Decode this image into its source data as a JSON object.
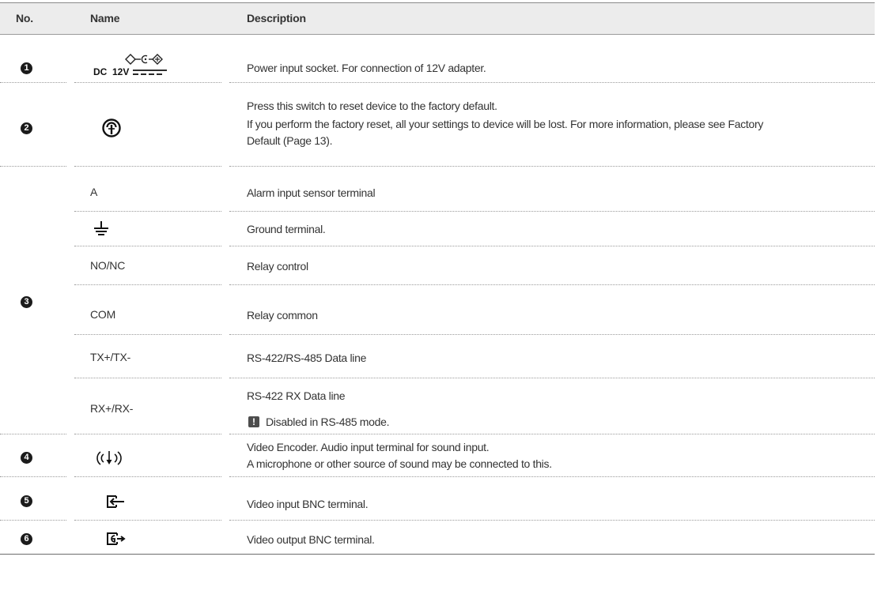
{
  "header": {
    "no": "No.",
    "name": "Name",
    "description": "Description"
  },
  "rows": [
    {
      "num": "1",
      "icon": "dc-power-icon",
      "icon_text": "DC 12V",
      "desc": [
        "Power input socket. For connection of 12V adapter."
      ]
    },
    {
      "num": "2",
      "icon": "reset-switch-icon",
      "desc": [
        "Press this switch to reset device to the factory default.",
        "If you perform the factory reset, all your settings to device will be lost. For more information, please see Factory",
        "Default (Page 13)."
      ]
    },
    {
      "num": "3",
      "sub": [
        {
          "name": "A",
          "desc": "Alarm input sensor terminal"
        },
        {
          "icon": "ground-icon",
          "desc": "Ground terminal."
        },
        {
          "name": "NO/NC",
          "desc": "Relay control"
        },
        {
          "name": "COM",
          "desc": "Relay common"
        },
        {
          "name": "TX+/TX-",
          "desc": "RS-422/RS-485 Data line"
        },
        {
          "name": "RX+/RX-",
          "desc": "RS-422 RX Data line",
          "note_icon": "!",
          "note": "Disabled in RS-485 mode."
        }
      ]
    },
    {
      "num": "4",
      "icon": "audio-input-icon",
      "desc": [
        "Video Encoder. Audio input terminal for sound input.",
        "A microphone or other source of sound may be connected to this."
      ]
    },
    {
      "num": "5",
      "icon": "video-input-icon",
      "desc": [
        "Video input BNC terminal."
      ]
    },
    {
      "num": "6",
      "icon": "video-output-icon",
      "desc": [
        "Video output BNC terminal."
      ]
    }
  ]
}
